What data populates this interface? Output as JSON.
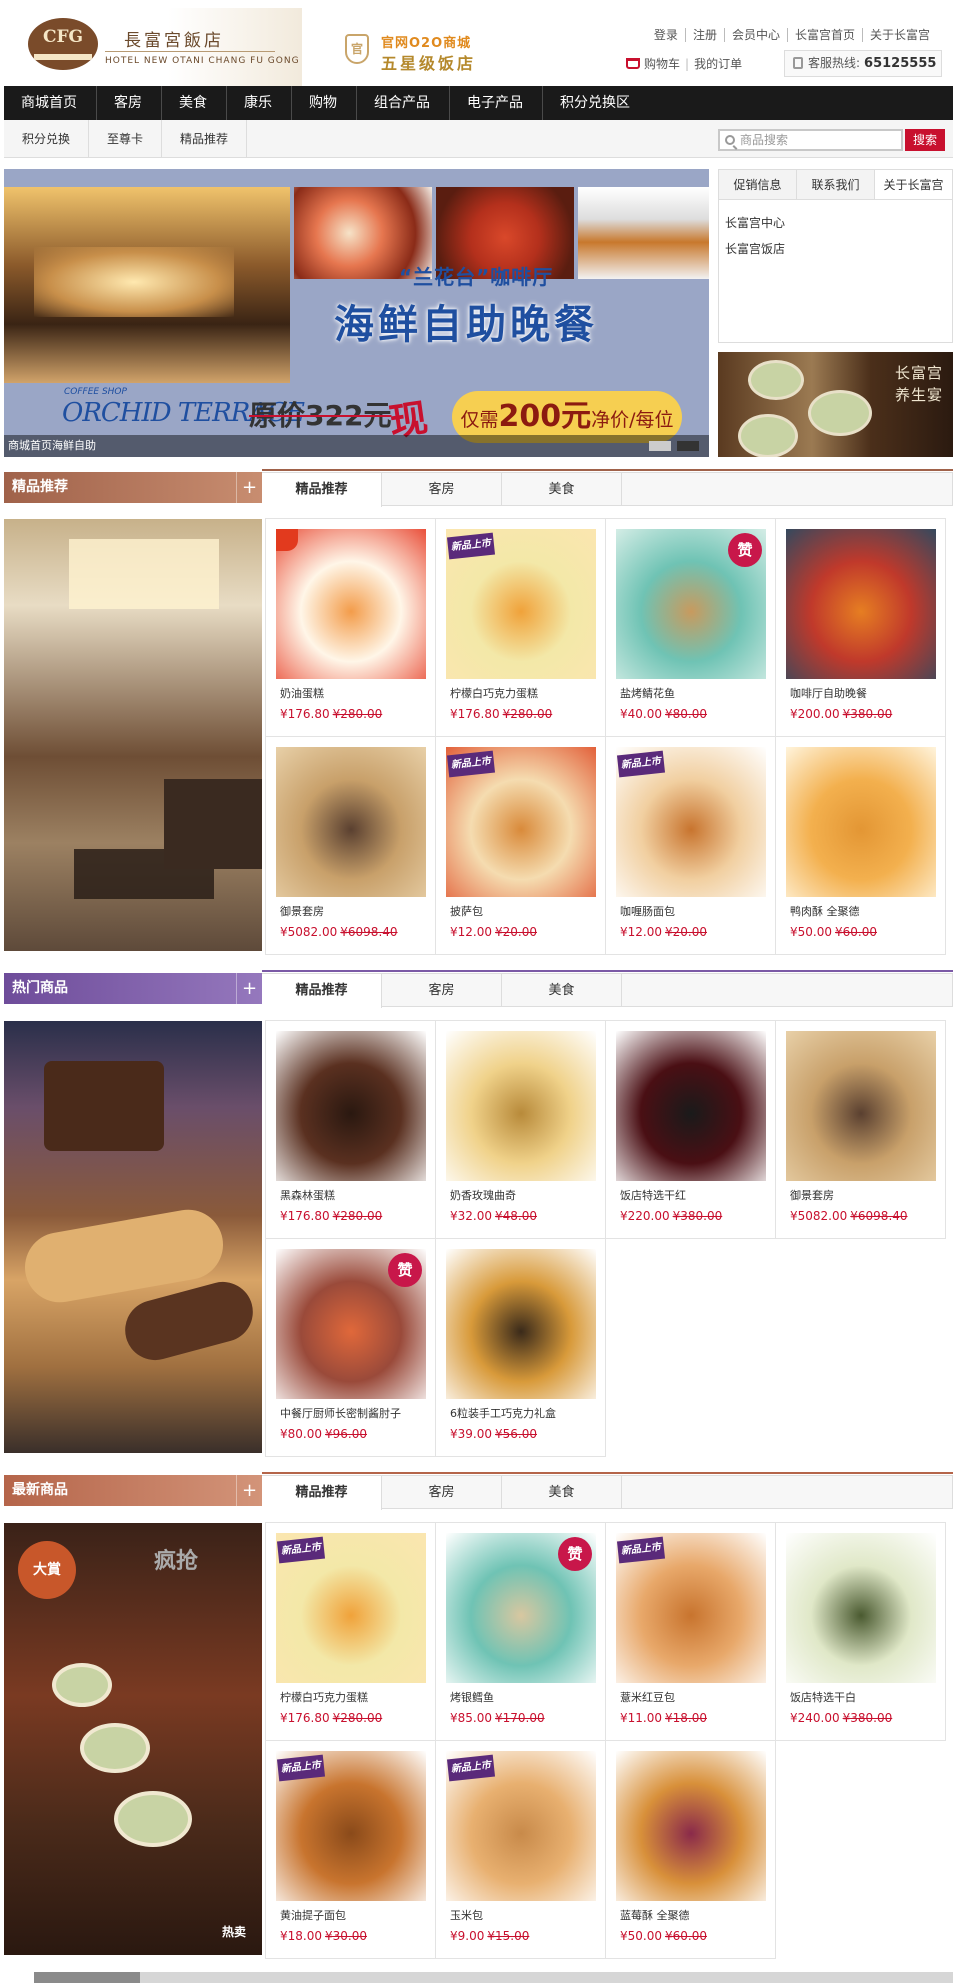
{
  "logo": {
    "cn": "長富宮飯店",
    "en": "HOTEL NEW OTANI CHANG FU GONG",
    "emblem": "CFG"
  },
  "o2o": {
    "shield": "官",
    "line1": "官网O2O商城",
    "line2": "五星级饭店"
  },
  "toplinks": [
    "登录",
    "注册",
    "会员中心",
    "长富宫首页",
    "关于长富宫"
  ],
  "cart": {
    "cart_label": "购物车",
    "orders_label": "我的订单",
    "sep": "|"
  },
  "hotline": {
    "label": "客服热线:",
    "number": "65125555"
  },
  "nav": [
    "商城首页",
    "客房",
    "美食",
    "康乐",
    "购物",
    "组合产品",
    "电子产品",
    "积分兑换区"
  ],
  "subnav": [
    "积分兑换",
    "至尊卡",
    "精品推荐"
  ],
  "search": {
    "placeholder": "商品搜索",
    "button": "搜索"
  },
  "banner": {
    "subtitle": "“兰花台”咖啡厅",
    "title": "海鲜自助晚餐",
    "coffee_shop": "COFFEE SHOP",
    "orchid": "ORCHID TERRACE",
    "old_price": "原价322元",
    "now": "现",
    "deal_prefix": "仅需",
    "deal_price": "200元",
    "deal_suffix": "净价/每位",
    "caption": "商城首页海鲜自助"
  },
  "side": {
    "tabs": [
      "促销信息",
      "联系我们",
      "关于长富宫"
    ],
    "links": [
      "长富宫中心",
      "长富宫饭店"
    ],
    "ad_line1": "长富宫",
    "ad_line2": "养生宴"
  },
  "colors": {
    "accent_red": "#c8102e",
    "sec1": "#a0624a",
    "sec2": "#7b5aa6",
    "sec3": "#b5654a"
  },
  "sections": [
    {
      "title": "精品推荐",
      "plus": "+",
      "tabs": [
        "精品推荐",
        "客房",
        "美食"
      ],
      "products": [
        {
          "name": "奶油蛋糕",
          "price": "¥176.80",
          "old": "¥280.00",
          "tag": "hot"
        },
        {
          "name": "柠檬白巧克力蛋糕",
          "price": "¥176.80",
          "old": "¥280.00",
          "tag": "new"
        },
        {
          "name": "盐烤鲭花鱼",
          "price": "¥40.00",
          "old": "¥80.00",
          "tag": "zan"
        },
        {
          "name": "咖啡厅自助晚餐",
          "price": "¥200.00",
          "old": "¥380.00",
          "tag": ""
        },
        {
          "name": "御景套房",
          "price": "¥5082.00",
          "old": "¥6098.40",
          "tag": ""
        },
        {
          "name": "披萨包",
          "price": "¥12.00",
          "old": "¥20.00",
          "tag": "new"
        },
        {
          "name": "咖喱肠面包",
          "price": "¥12.00",
          "old": "¥20.00",
          "tag": "new"
        },
        {
          "name": "鸭肉酥 全聚德",
          "price": "¥50.00",
          "old": "¥60.00",
          "tag": ""
        }
      ]
    },
    {
      "title": "热门商品",
      "plus": "+",
      "tabs": [
        "精品推荐",
        "客房",
        "美食"
      ],
      "products": [
        {
          "name": "黑森林蛋糕",
          "price": "¥176.80",
          "old": "¥280.00",
          "tag": ""
        },
        {
          "name": "奶香玫瑰曲奇",
          "price": "¥32.00",
          "old": "¥48.00",
          "tag": ""
        },
        {
          "name": "饭店特选干红",
          "price": "¥220.00",
          "old": "¥380.00",
          "tag": ""
        },
        {
          "name": "御景套房",
          "price": "¥5082.00",
          "old": "¥6098.40",
          "tag": ""
        },
        {
          "name": "中餐厅厨师长密制酱肘子",
          "price": "¥80.00",
          "old": "¥96.00",
          "tag": "zan"
        },
        {
          "name": "6粒装手工巧克力礼盒",
          "price": "¥39.00",
          "old": "¥56.00",
          "tag": ""
        }
      ]
    },
    {
      "title": "最新商品",
      "plus": "+",
      "tabs": [
        "精品推荐",
        "客房",
        "美食"
      ],
      "products": [
        {
          "name": "柠檬白巧克力蛋糕",
          "price": "¥176.80",
          "old": "¥280.00",
          "tag": "new"
        },
        {
          "name": "烤银鳕鱼",
          "price": "¥85.00",
          "old": "¥170.00",
          "tag": "zan"
        },
        {
          "name": "薏米红豆包",
          "price": "¥11.00",
          "old": "¥18.00",
          "tag": "new"
        },
        {
          "name": "饭店特选干白",
          "price": "¥240.00",
          "old": "¥380.00",
          "tag": ""
        },
        {
          "name": "黄油提子面包",
          "price": "¥18.00",
          "old": "¥30.00",
          "tag": "new"
        },
        {
          "name": "玉米包",
          "price": "¥9.00",
          "old": "¥15.00",
          "tag": "new"
        },
        {
          "name": "蓝莓酥 全聚德",
          "price": "¥50.00",
          "old": "¥60.00",
          "tag": ""
        }
      ]
    }
  ],
  "tags": {
    "new": "新品上市",
    "zan": "赞"
  },
  "sec_side": {
    "s3_badge1": "大賞",
    "s3_badge2": "疯抢",
    "s3_hot": "热卖"
  }
}
